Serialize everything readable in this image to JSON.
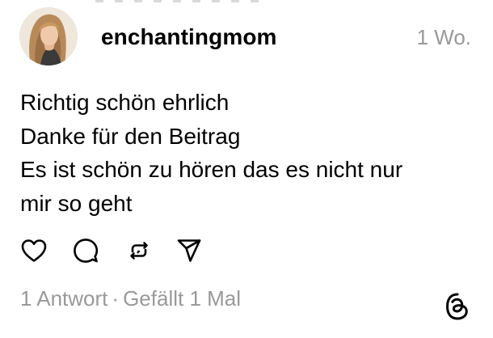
{
  "post": {
    "username": "enchantingmom",
    "timestamp": "1 Wo.",
    "lines": [
      "Richtig schön ehrlich",
      "Danke für den Beitrag",
      "Es ist schön zu hören das es nicht nur",
      "mir so geht"
    ]
  },
  "stats": {
    "replies": "1 Antwort",
    "separator": "·",
    "likes": "Gefällt 1 Mal"
  },
  "icons": {
    "like": "heart-icon",
    "reply": "comment-icon",
    "repost": "repost-icon",
    "share": "send-icon",
    "brand": "threads-logo-icon"
  },
  "colors": {
    "text": "#000000",
    "muted": "#999999",
    "background": "#ffffff"
  }
}
